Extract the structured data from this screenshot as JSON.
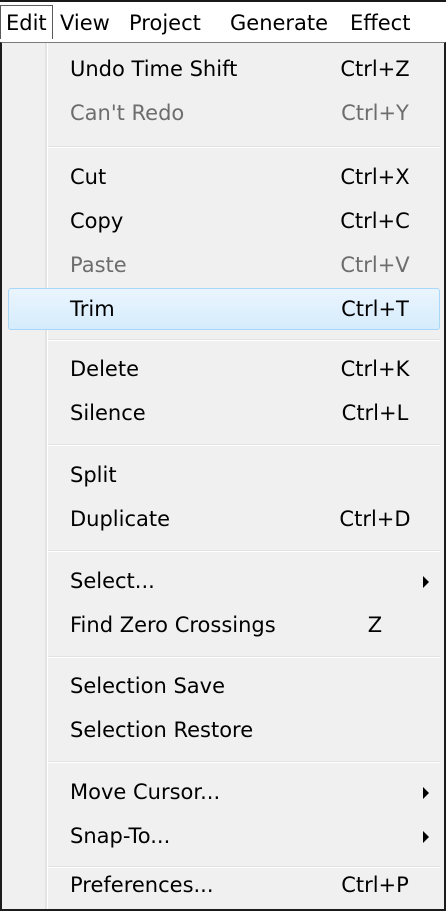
{
  "menubar": {
    "items": [
      "Edit",
      "View",
      "Project",
      "Generate",
      "Effect"
    ],
    "active": "Edit"
  },
  "menu": {
    "items": [
      {
        "label": "Undo Time Shift",
        "shortcut": "Ctrl+Z",
        "enabled": true
      },
      {
        "label": "Can't Redo",
        "shortcut": "Ctrl+Y",
        "enabled": false
      },
      {
        "label": "Cut",
        "shortcut": "Ctrl+X",
        "enabled": true
      },
      {
        "label": "Copy",
        "shortcut": "Ctrl+C",
        "enabled": true
      },
      {
        "label": "Paste",
        "shortcut": "Ctrl+V",
        "enabled": false
      },
      {
        "label": "Trim",
        "shortcut": "Ctrl+T",
        "enabled": true,
        "highlighted": true
      },
      {
        "label": "Delete",
        "shortcut": "Ctrl+K",
        "enabled": true
      },
      {
        "label": "Silence",
        "shortcut": "Ctrl+L",
        "enabled": true
      },
      {
        "label": "Split",
        "shortcut": "",
        "enabled": true
      },
      {
        "label": "Duplicate",
        "shortcut": "Ctrl+D",
        "enabled": true
      },
      {
        "label": "Select...",
        "shortcut": "",
        "enabled": true,
        "submenu": true
      },
      {
        "label": "Find Zero Crossings",
        "shortcut": "Z",
        "enabled": true
      },
      {
        "label": "Selection Save",
        "shortcut": "",
        "enabled": true
      },
      {
        "label": "Selection Restore",
        "shortcut": "",
        "enabled": true
      },
      {
        "label": "Move Cursor...",
        "shortcut": "",
        "enabled": true,
        "submenu": true
      },
      {
        "label": "Snap-To...",
        "shortcut": "",
        "enabled": true,
        "submenu": true
      },
      {
        "label": "Preferences...",
        "shortcut": "Ctrl+P",
        "enabled": true
      }
    ]
  },
  "icons": {
    "submenu_arrow": "chevron-right-icon"
  },
  "colors": {
    "highlight_fill": "#d6ecfc",
    "highlight_border": "#a8d8f9",
    "disabled_text": "#6d6d6d",
    "menu_background": "#f0f0f0"
  }
}
